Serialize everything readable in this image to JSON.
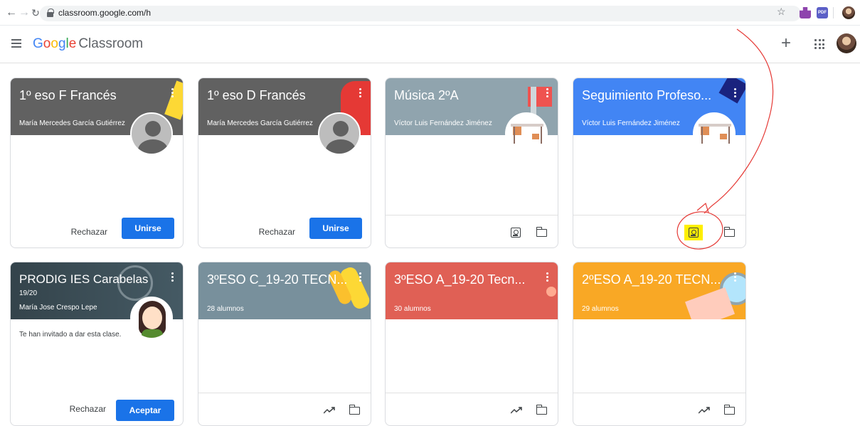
{
  "browser": {
    "url": "classroom.google.com/h"
  },
  "app": {
    "brand_google": "Google",
    "brand_product": "Classroom",
    "brand_colors": [
      "#4285f4",
      "#ea4335",
      "#fbbc05",
      "#4285f4",
      "#34a853",
      "#ea4335"
    ]
  },
  "cards": [
    {
      "title": "1º eso F Francés",
      "subtitle": "María Mercedes García Gutiérrez",
      "header_color": "#616161",
      "reject_label": "Rechazar",
      "accept_label": "Unirse"
    },
    {
      "title": "1º eso D Francés",
      "subtitle": "María Mercedes García Gutiérrez",
      "header_color": "#616161",
      "reject_label": "Rechazar",
      "accept_label": "Unirse"
    },
    {
      "title": "Música 2ºA",
      "subtitle": "Víctor Luis Fernández Jiménez",
      "header_color": "#90a4ae"
    },
    {
      "title": "Seguimiento Profeso...",
      "subtitle": "Víctor Luis Fernández Jiménez",
      "header_color": "#4285f4"
    },
    {
      "title": "PRODIG IES Carabelas",
      "section": "19/20",
      "subtitle": "María Jose Crespo Lepe",
      "header_color": "#455a64",
      "note": "Te han invitado a dar esta clase.",
      "reject_label": "Rechazar",
      "accept_label": "Aceptar"
    },
    {
      "title": "3ºESO C_19-20 TECN...",
      "subtitle": "28 alumnos",
      "header_color": "#78909c"
    },
    {
      "title": "3ºESO A_19-20 Tecn...",
      "subtitle": "30 alumnos",
      "header_color": "#e06055"
    },
    {
      "title": "2ºESO A_19-20 TECN...",
      "subtitle": "29 alumnos",
      "header_color": "#f9a825"
    }
  ],
  "annotation_color": "#e53935",
  "highlight_color": "#ffef00"
}
